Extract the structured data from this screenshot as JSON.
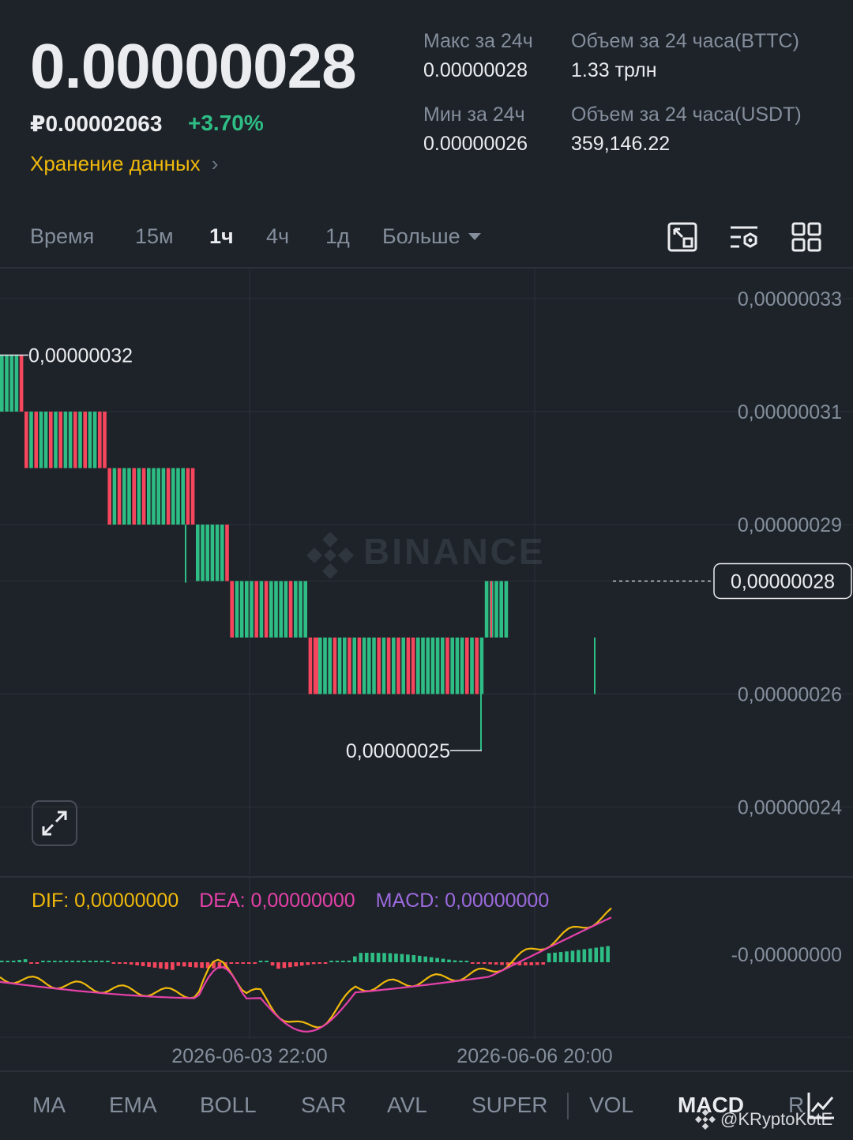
{
  "header": {
    "price": "0.00000028",
    "price_rub": "₽0.00002063",
    "change": "+3.70%",
    "storage_link": "Хранение данных",
    "stats": {
      "max_label": "Макс за 24ч",
      "max_value": "0.00000028",
      "min_label": "Мин за 24ч",
      "min_value": "0.00000026",
      "vol_bttc_label": "Объем за 24 часа(BTTC)",
      "vol_bttc_value": "1.33 трлн",
      "vol_usdt_label": "Объем за 24 часа(USDT)",
      "vol_usdt_value": "359,146.22"
    }
  },
  "timeframes": {
    "time": "Время",
    "m15": "15м",
    "h1": "1ч",
    "h4": "4ч",
    "d1": "1д",
    "more": "Больше"
  },
  "icons": {
    "tool1": "chart-settings-icon",
    "tool2": "indicator-settings-icon",
    "tool3": "grid-layout-icon",
    "expand": "expand-icon"
  },
  "macd_legend": {
    "dif": "DIF: 0,00000000",
    "dea": "DEA: 0,00000000",
    "macd": "MACD: 0,00000000"
  },
  "indicators": {
    "ma": "MA",
    "ema": "EMA",
    "boll": "BOLL",
    "sar": "SAR",
    "avl": "AVL",
    "super": "SUPER",
    "vol": "VOL",
    "macd": "MACD",
    "r": "R"
  },
  "watermark": {
    "brand": "BINANCE",
    "author": "@KRyptoKotE"
  },
  "colors": {
    "up": "#2ebd85",
    "down": "#f6465d",
    "dif": "#f0b90b",
    "dea": "#e541a9",
    "macd": "#9c6ade",
    "grid": "#2b3139",
    "axis_text": "#848e9c"
  },
  "chart_data": {
    "type": "candlestick",
    "interval": "1ч",
    "y_axis_labels": [
      "0,00000033",
      "0,00000031",
      "0,00000029",
      "0,00000028",
      "0,00000026",
      "0,00000024"
    ],
    "y_range": [
      2.4e-07,
      3.3e-07
    ],
    "x_axis_labels": [
      "2026-06-03 22:00",
      "2026-06-06 20:00"
    ],
    "last_price_label": "0,00000028",
    "high_marker": "0,00000032",
    "low_marker": "0,00000025",
    "macd_axis_label": "-0,00000000",
    "segments": [
      {
        "level_from": 3.2e-07,
        "level_to": 3.1e-07,
        "count": 5,
        "mix": [
          1,
          1,
          1,
          1,
          0
        ]
      },
      {
        "level_from": 3.1e-07,
        "level_to": 3e-07,
        "count": 17,
        "mix": [
          0,
          1,
          0,
          1,
          1,
          0,
          1,
          0,
          1,
          1,
          0,
          1,
          0,
          1,
          1,
          0,
          0
        ]
      },
      {
        "level_from": 3e-07,
        "level_to": 2.9e-07,
        "count": 18,
        "mix": [
          0,
          1,
          0,
          1,
          1,
          0,
          1,
          0,
          1,
          1,
          1,
          1,
          0,
          1,
          1,
          1,
          0,
          0
        ]
      },
      {
        "level_from": 2.9e-07,
        "level_to": 2.8e-07,
        "count": 7,
        "mix": [
          1,
          1,
          1,
          1,
          1,
          1,
          0
        ]
      },
      {
        "level_from": 2.8e-07,
        "level_to": 2.7e-07,
        "count": 16,
        "mix": [
          0,
          1,
          1,
          1,
          1,
          0,
          1,
          0,
          1,
          1,
          1,
          1,
          0,
          1,
          1,
          1
        ]
      },
      {
        "level_from": 2.7e-07,
        "level_to": 2.6e-07,
        "count": 36,
        "mix": [
          0,
          0,
          1,
          1,
          1,
          0,
          1,
          1,
          0,
          1,
          0,
          1,
          1,
          1,
          0,
          1,
          0,
          1,
          0,
          1,
          0,
          0,
          1,
          1,
          1,
          1,
          1,
          1,
          0,
          1,
          1,
          1,
          0,
          1,
          0,
          1
        ]
      },
      {
        "level_from": 2.8e-07,
        "level_to": 2.7e-07,
        "count": 5,
        "mix": [
          1,
          1,
          1,
          1,
          1
        ]
      }
    ]
  }
}
